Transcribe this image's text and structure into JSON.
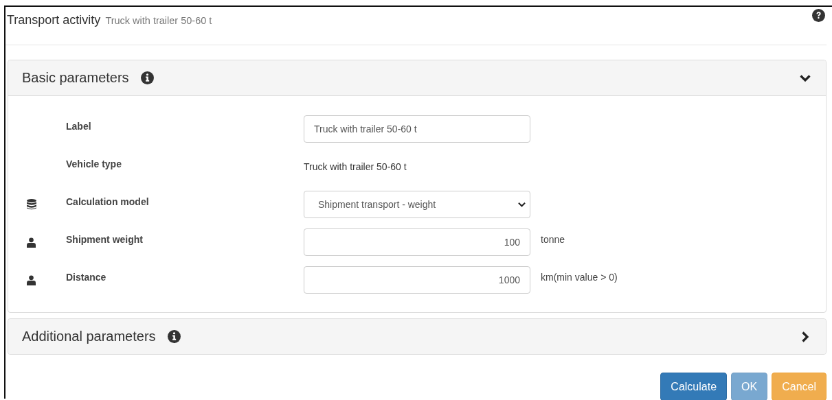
{
  "dialog": {
    "title": "Transport activity",
    "subtitle": "Truck with trailer 50-60 t"
  },
  "panels": [
    {
      "title": "Basic parameters",
      "expanded": true,
      "fields": [
        {
          "label": "Label",
          "kind": "text",
          "value": "Truck with trailer 50-60 t"
        },
        {
          "label": "Vehicle type",
          "kind": "static",
          "value": "Truck with trailer 50-60 t"
        },
        {
          "label": "Calculation model",
          "kind": "select",
          "value": "Shipment transport - weight"
        },
        {
          "label": "Shipment weight",
          "kind": "number",
          "value": "100",
          "unit": "tonne"
        },
        {
          "label": "Distance",
          "kind": "number",
          "value": "1000",
          "unit": "km(min value > 0)"
        }
      ]
    },
    {
      "title": "Additional parameters",
      "expanded": false
    }
  ],
  "buttons": [
    {
      "label": "Calculate",
      "kind": "primary",
      "disabled": false
    },
    {
      "label": "OK",
      "kind": "primary",
      "disabled": true
    },
    {
      "label": "Cancel",
      "kind": "warning",
      "disabled": false
    }
  ]
}
